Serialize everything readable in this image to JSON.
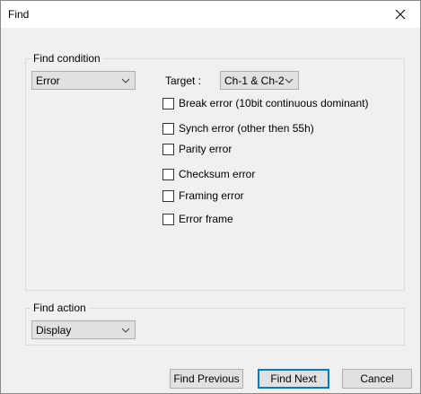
{
  "window": {
    "title": "Find"
  },
  "find_condition": {
    "legend": "Find condition",
    "type_value": "Error",
    "target_label": "Target :",
    "target_value": "Ch-1 & Ch-2",
    "checkboxes": [
      {
        "label": "Break error (10bit continuous dominant)",
        "checked": false
      },
      {
        "label": "Synch error (other then 55h)",
        "checked": false
      },
      {
        "label": "Parity error",
        "checked": false
      },
      {
        "label": "Checksum error",
        "checked": false
      },
      {
        "label": "Framing error",
        "checked": false
      },
      {
        "label": "Error frame",
        "checked": false
      }
    ]
  },
  "find_action": {
    "legend": "Find action",
    "value": "Display"
  },
  "buttons": {
    "find_previous": "Find Previous",
    "find_next": "Find Next",
    "cancel": "Cancel"
  },
  "icons": {
    "close": "close-icon",
    "dropdown": "chevron-down-icon"
  },
  "colors": {
    "accent": "#0078d7",
    "background": "#f0f0f0"
  }
}
